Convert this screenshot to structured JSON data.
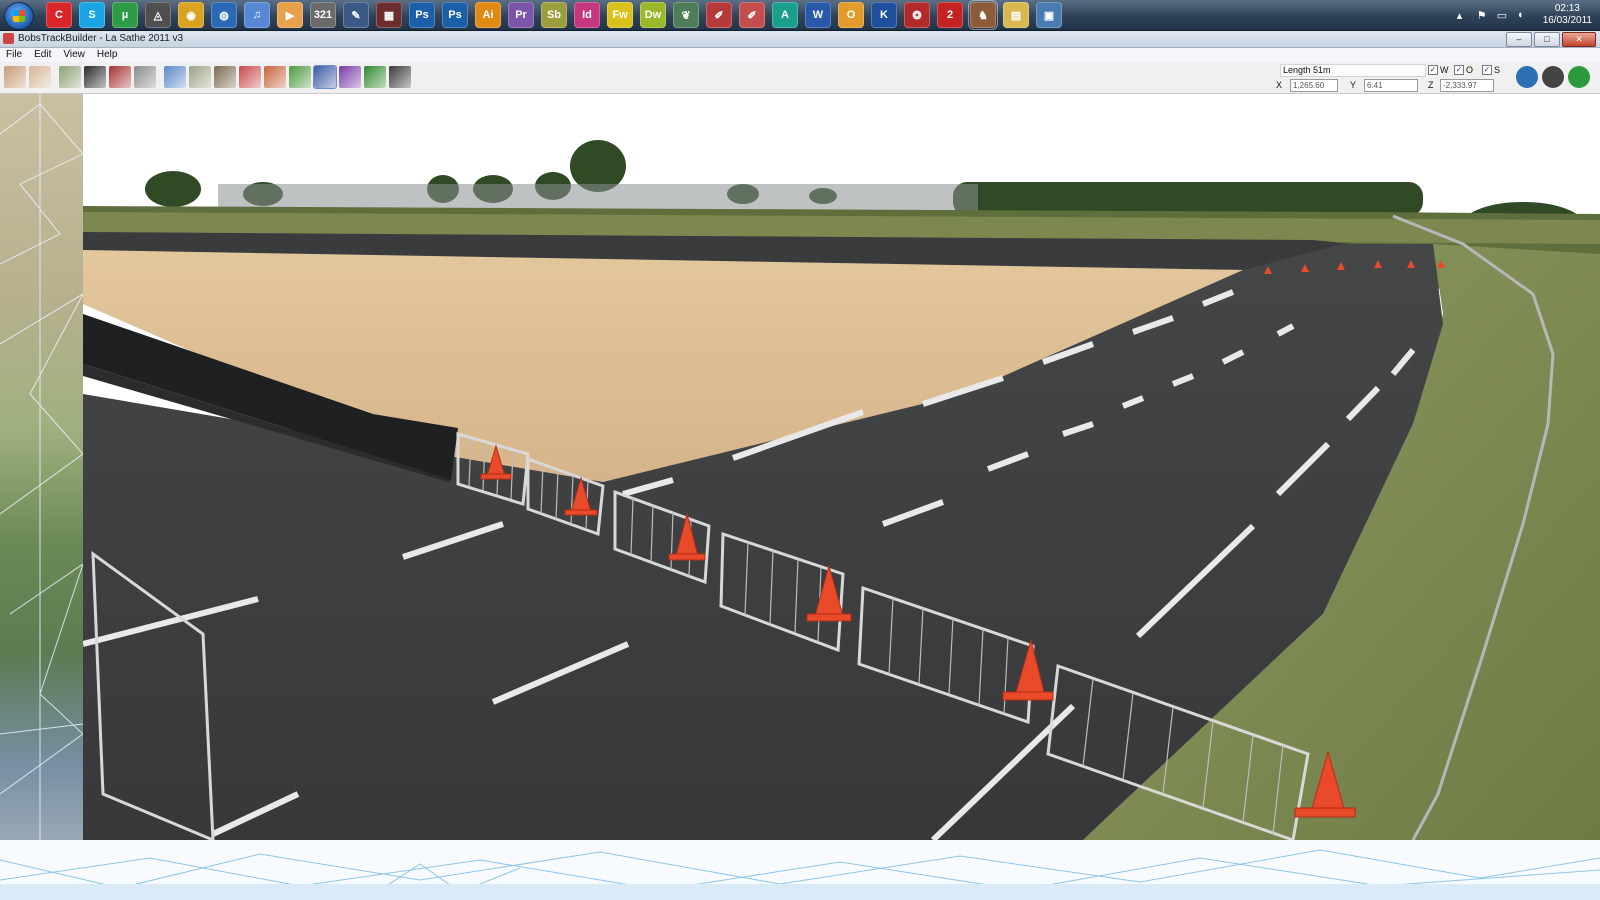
{
  "taskbar": {
    "pinned_apps": [
      {
        "name": "ccleaner",
        "label": "C",
        "color": "#d8262b"
      },
      {
        "name": "skype",
        "label": "S",
        "color": "#19a4e6"
      },
      {
        "name": "utorrent",
        "label": "µ",
        "color": "#2e9c47"
      },
      {
        "name": "unity",
        "label": "◬",
        "color": "#4f4f4f"
      },
      {
        "name": "chrome",
        "label": "◉",
        "color": "#d9a21f"
      },
      {
        "name": "google-earth",
        "label": "◍",
        "color": "#2969b5"
      },
      {
        "name": "itunes",
        "label": "♫",
        "color": "#5688d6"
      },
      {
        "name": "media-player",
        "label": "▶",
        "color": "#e9a04b"
      },
      {
        "name": "calendar",
        "label": "321",
        "color": "#6a6a6a"
      },
      {
        "name": "editor",
        "label": "✎",
        "color": "#3b5a86"
      },
      {
        "name": "film-app",
        "label": "▦",
        "color": "#6b2d2d"
      },
      {
        "name": "photoshop-1",
        "label": "Ps",
        "color": "#1b5fa8"
      },
      {
        "name": "photoshop-2",
        "label": "Ps",
        "color": "#1b5fa8"
      },
      {
        "name": "illustrator",
        "label": "Ai",
        "color": "#e08a14"
      },
      {
        "name": "premiere",
        "label": "Pr",
        "color": "#7b55a8"
      },
      {
        "name": "soundbooth",
        "label": "Sb",
        "color": "#9c9d3b"
      },
      {
        "name": "indesign",
        "label": "Id",
        "color": "#c5377e"
      },
      {
        "name": "fireworks",
        "label": "Fw",
        "color": "#d8c21a"
      },
      {
        "name": "dreamweaver",
        "label": "Dw",
        "color": "#9ab82a"
      },
      {
        "name": "butterfly-app",
        "label": "❦",
        "color": "#4f7d5a"
      },
      {
        "name": "pencil-app-1",
        "label": "✐",
        "color": "#b73a3a"
      },
      {
        "name": "pencil-app-2",
        "label": "✐",
        "color": "#c44d4d"
      },
      {
        "name": "app-a",
        "label": "A",
        "color": "#1a9f8c"
      },
      {
        "name": "word",
        "label": "W",
        "color": "#2858a8"
      },
      {
        "name": "outlook",
        "label": "O",
        "color": "#e39b2b"
      },
      {
        "name": "app-k",
        "label": "K",
        "color": "#1f4f9c"
      },
      {
        "name": "red-app",
        "label": "❂",
        "color": "#b32a2a"
      },
      {
        "name": "app-2",
        "label": "2",
        "color": "#c42323"
      },
      {
        "name": "track-builder",
        "label": "♞",
        "color": "#8c5b3a"
      },
      {
        "name": "explorer",
        "label": "▤",
        "color": "#d9b84f"
      },
      {
        "name": "display-app",
        "label": "▣",
        "color": "#4a7bb0"
      }
    ],
    "clock": {
      "time": "02:13",
      "date": "16/03/2011"
    }
  },
  "window": {
    "title": "BobsTrackBuilder - La Sathe 2011 v3",
    "controls": {
      "minimize": "–",
      "maximize": "□",
      "close": "✕"
    }
  },
  "menu": {
    "items": [
      "File",
      "Edit",
      "View",
      "Help"
    ]
  },
  "toolbar": {
    "tools": [
      {
        "name": "node-tool-1",
        "color": "#c79a78"
      },
      {
        "name": "node-tool-2",
        "color": "#d7b598"
      },
      {
        "name": "terrain-tool",
        "color": "#8da274"
      },
      {
        "name": "light-tool",
        "color": "#2a2a2a"
      },
      {
        "name": "wall-tool",
        "color": "#a83232"
      },
      {
        "name": "pole-tool",
        "color": "#8a8a8a"
      },
      {
        "name": "spline-tool",
        "color": "#5a88c8"
      },
      {
        "name": "road-tool",
        "color": "#9aa386"
      },
      {
        "name": "texture-tool",
        "color": "#7a6a4f"
      },
      {
        "name": "eraser-tool",
        "color": "#c84a4a"
      },
      {
        "name": "brick-tool",
        "color": "#c6633a"
      },
      {
        "name": "mountain-tool",
        "color": "#4c9a3f"
      },
      {
        "name": "objects-tool",
        "color": "#3b59a7",
        "selected": true
      },
      {
        "name": "paint-tool",
        "color": "#7a3aa8"
      },
      {
        "name": "flag-tool",
        "color": "#2d8a2d"
      },
      {
        "name": "camera-tool",
        "color": "#3a3a3a"
      }
    ],
    "length_label": "Length 51m",
    "x_label": "X",
    "x_value": "1,265.60",
    "y_label": "Y",
    "y_value": "6.41",
    "z_label": "Z",
    "z_value": "-2,333.97",
    "checkboxes": [
      {
        "label": "W",
        "checked": true
      },
      {
        "label": "O",
        "checked": true
      },
      {
        "label": "S",
        "checked": true
      }
    ],
    "right_tools": [
      {
        "name": "helicopter-tool",
        "color": "#2c6fb3"
      },
      {
        "name": "steering-wheel-tool",
        "color": "#444"
      },
      {
        "name": "walk-tool",
        "color": "#2b9a3a"
      }
    ]
  },
  "colors": {
    "asphalt": "#3e3f41",
    "sand": "#d9bc92",
    "grass": "#7f8a55",
    "sky": "#ffffff",
    "cone": "#e84a2a"
  }
}
